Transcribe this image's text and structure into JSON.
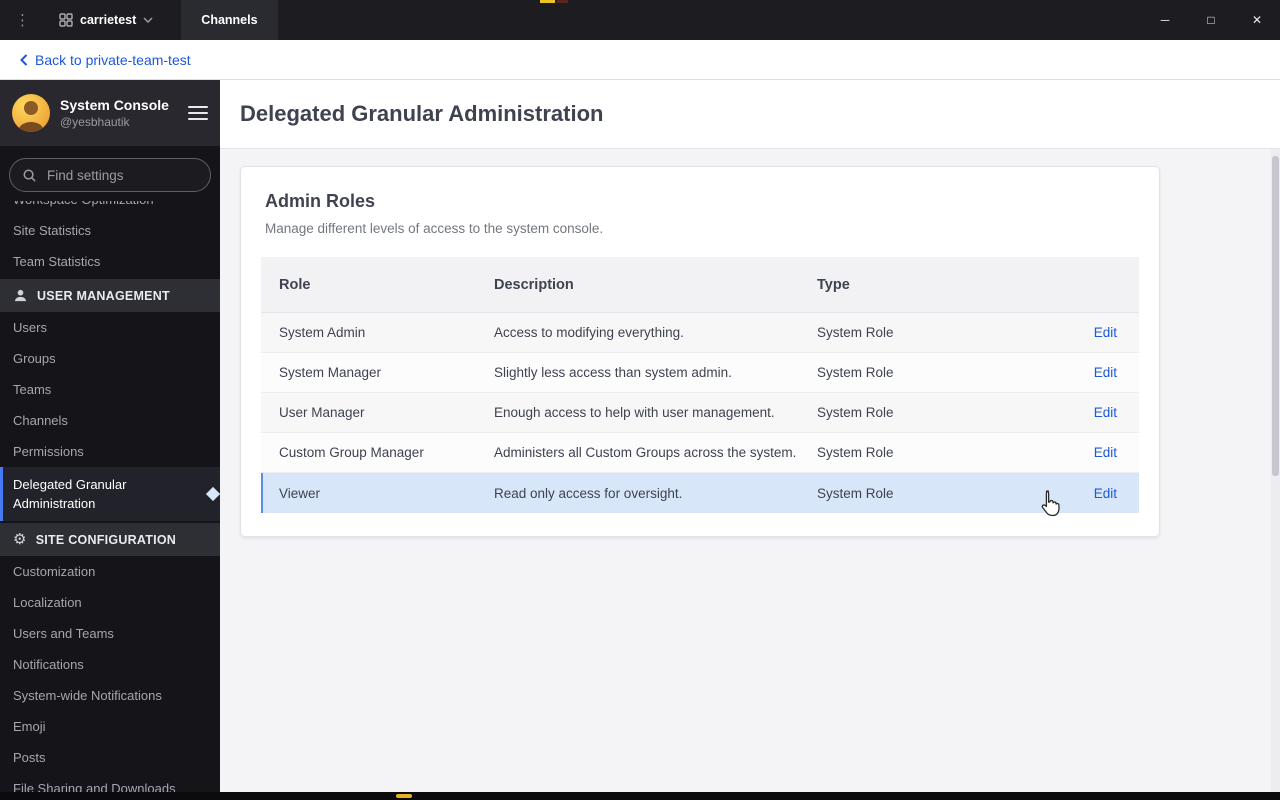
{
  "icons": {
    "app_menu": "⋮",
    "gear": "⚙",
    "minimize": "─",
    "maximize": "□",
    "close": "✕"
  },
  "titlebar": {
    "server_name": "carrietest",
    "tab_label": "Channels"
  },
  "back_bar": {
    "link_label": "Back to private-team-test"
  },
  "sidebar": {
    "header": {
      "title": "System Console",
      "handle": "@yesbhautik"
    },
    "search": {
      "placeholder": "Find settings"
    },
    "clipped_item": "Workspace Optimization",
    "top_items": [
      "Site Statistics",
      "Team Statistics"
    ],
    "user_management": {
      "label": "USER MANAGEMENT",
      "items": [
        "Users",
        "Groups",
        "Teams",
        "Channels",
        "Permissions"
      ],
      "active_item": "Delegated Granular Administration"
    },
    "site_configuration": {
      "label": "SITE CONFIGURATION",
      "items": [
        "Customization",
        "Localization",
        "Users and Teams",
        "Notifications",
        "System-wide Notifications",
        "Emoji",
        "Posts",
        "File Sharing and Downloads"
      ]
    }
  },
  "main": {
    "page_title": "Delegated Granular Administration",
    "card": {
      "title": "Admin Roles",
      "subtitle": "Manage different levels of access to the system console.",
      "table": {
        "columns": [
          "Role",
          "Description",
          "Type"
        ],
        "action_label": "Edit",
        "rows": [
          {
            "role": "System Admin",
            "description": "Access to modifying everything.",
            "type": "System Role"
          },
          {
            "role": "System Manager",
            "description": "Slightly less access than system admin.",
            "type": "System Role"
          },
          {
            "role": "User Manager",
            "description": "Enough access to help with user management.",
            "type": "System Role"
          },
          {
            "role": "Custom Group Manager",
            "description": "Administers all Custom Groups across the system.",
            "type": "System Role"
          },
          {
            "role": "Viewer",
            "description": "Read only access for oversight.",
            "type": "System Role"
          }
        ]
      }
    }
  },
  "colors": {
    "accent_blue": "#1c58d9",
    "active_border": "#4779f0",
    "highlight_row": "#d8e6f9",
    "titlebar_bg": "#1c1c21",
    "sidebar_bg": "#141419"
  }
}
